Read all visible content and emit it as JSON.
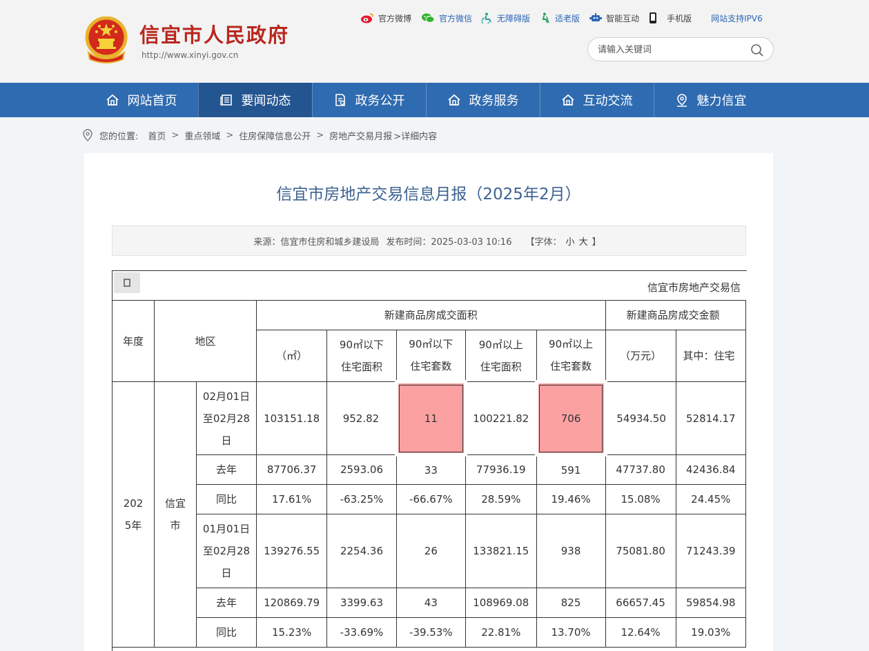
{
  "header": {
    "site_title": "信宜市人民政府",
    "site_url": "http://www.xinyi.gov.cn",
    "toplinks": [
      {
        "label": "官方微博",
        "icon": "weibo-icon"
      },
      {
        "label": "官方微信",
        "icon": "wechat-icon"
      },
      {
        "label": "无障碍版",
        "icon": "accessibility-icon"
      },
      {
        "label": "适老版",
        "icon": "elderly-icon"
      },
      {
        "label": "智能互动",
        "icon": "robot-icon"
      },
      {
        "label": "手机版",
        "icon": "mobile-icon"
      },
      {
        "label": "网站支持IPV6",
        "icon": ""
      }
    ],
    "search_placeholder": "请输入关键词"
  },
  "nav": {
    "items": [
      {
        "label": "网站首页",
        "icon": "home-icon"
      },
      {
        "label": "要闻动态",
        "icon": "news-icon"
      },
      {
        "label": "政务公开",
        "icon": "document-icon"
      },
      {
        "label": "政务服务",
        "icon": "home-icon"
      },
      {
        "label": "互动交流",
        "icon": "home-icon"
      },
      {
        "label": "魅力信宜",
        "icon": "location-icon"
      }
    ],
    "active_index": 1
  },
  "breadcrumb": {
    "prefix": "您的位置:",
    "items": [
      "首页",
      "重点领域",
      "住房保障信息公开",
      "房地产交易月报"
    ],
    "tail": ">详细内容"
  },
  "article": {
    "title": "信宜市房地产交易信息月报（2025年2月）",
    "source": "来源：信宜市住房和城乡建设局",
    "published": "发布时间：2025-03-03 10:16",
    "font_label": "【字体：",
    "font_small": "小",
    "font_large": "大",
    "font_end": "】"
  },
  "table": {
    "caption": "信宜市房地产交易信",
    "headers": {
      "year": "年度",
      "region": "地区",
      "group_area": "新建商品房成交面积",
      "group_amount": "新建商品房成交金额",
      "col_area_unit": "（㎡）",
      "col_u90_area": "90㎡以下住宅面积",
      "col_u90_count": "90㎡以以下住宅套数",
      "col_o90_area": "90㎡以上住宅面积",
      "col_o90_count": "90㎡以上住宅套数",
      "col_amount_unit": "（万元）",
      "col_amount_res": "其中：住宅"
    },
    "year_value": "2025年",
    "region_value": "信宜市",
    "rows": [
      {
        "period": "02月01日至02月28日",
        "values": [
          "103151.18",
          "952.82",
          "11",
          "100221.82",
          "706",
          "54934.50",
          "52814.17"
        ]
      },
      {
        "period": "去年",
        "values": [
          "87706.37",
          "2593.06",
          "33",
          "77936.19",
          "591",
          "47737.80",
          "42436.84"
        ]
      },
      {
        "period": "同比",
        "values": [
          "17.61%",
          "-63.25%",
          "-66.67%",
          "28.59%",
          "19.46%",
          "15.08%",
          "24.45%"
        ]
      },
      {
        "period": "01月01日至02月28日",
        "values": [
          "139276.55",
          "2254.36",
          "26",
          "133821.15",
          "938",
          "75081.80",
          "71243.39"
        ]
      },
      {
        "period": "去年",
        "values": [
          "120869.79",
          "3399.63",
          "43",
          "108969.08",
          "825",
          "66657.45",
          "59854.98"
        ]
      },
      {
        "period": "同比",
        "values": [
          "15.23%",
          "-33.69%",
          "-39.53%",
          "22.81%",
          "13.70%",
          "12.64%",
          "19.03%"
        ]
      }
    ],
    "highlight_color": "#fca1a2"
  },
  "colors": {
    "nav_bg": "#2f6bb1",
    "nav_active": "#235591",
    "title_red": "#b8271f",
    "article_title": "#3c6292"
  }
}
